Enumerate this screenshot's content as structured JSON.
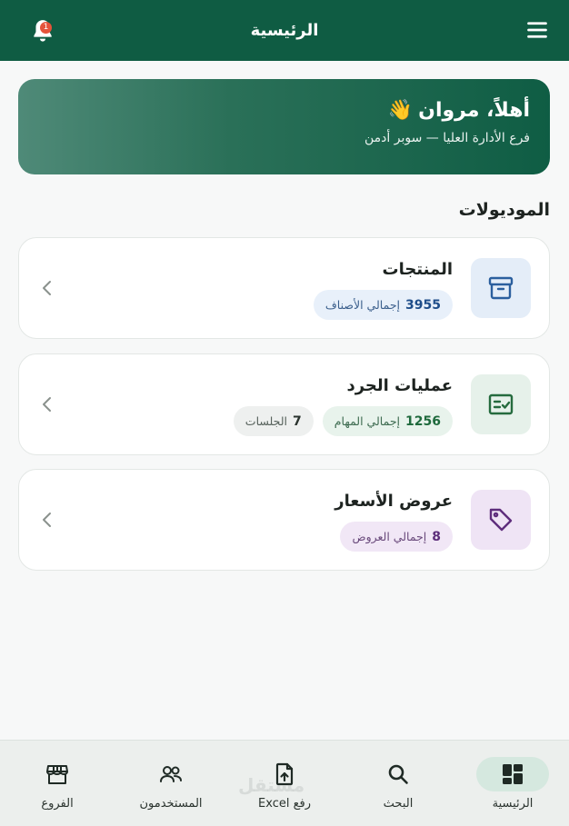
{
  "app_bar": {
    "title": "الرئيسية",
    "notification_count": "1"
  },
  "welcome": {
    "greeting": "أهلاً، مروان",
    "emoji": "👋",
    "subtitle": "فرع الأدارة العليا — سوبر أدمن"
  },
  "section_title": "الموديولات",
  "modules": [
    {
      "name": "المنتجات",
      "icon": "archive-box-icon",
      "chips": [
        {
          "value": "3955",
          "label": "إجمالي الأصناف"
        }
      ]
    },
    {
      "name": "عمليات الجرد",
      "icon": "checklist-icon",
      "chips": [
        {
          "value": "1256",
          "label": "إجمالي المهام"
        },
        {
          "value": "7",
          "label": "الجلسات"
        }
      ]
    },
    {
      "name": "عروض الأسعار",
      "icon": "price-tag-icon",
      "chips": [
        {
          "value": "8",
          "label": "إجمالي العروض"
        }
      ]
    }
  ],
  "bottom_nav": [
    {
      "label": "الرئيسية",
      "icon": "dashboard-icon",
      "active": true
    },
    {
      "label": "البحث",
      "icon": "search-icon",
      "active": false
    },
    {
      "label": "رفع Excel",
      "icon": "file-upload-icon",
      "active": false
    },
    {
      "label": "المستخدمون",
      "icon": "users-icon",
      "active": false
    },
    {
      "label": "الفروع",
      "icon": "store-icon",
      "active": false
    }
  ],
  "watermark": "مستقل",
  "colors": {
    "primary": "#0f5c43",
    "badge": "#e5533a",
    "blue_chip": "#e8f0fa",
    "green_chip": "#e8f3ec",
    "purple_chip": "#f1e7f6"
  }
}
